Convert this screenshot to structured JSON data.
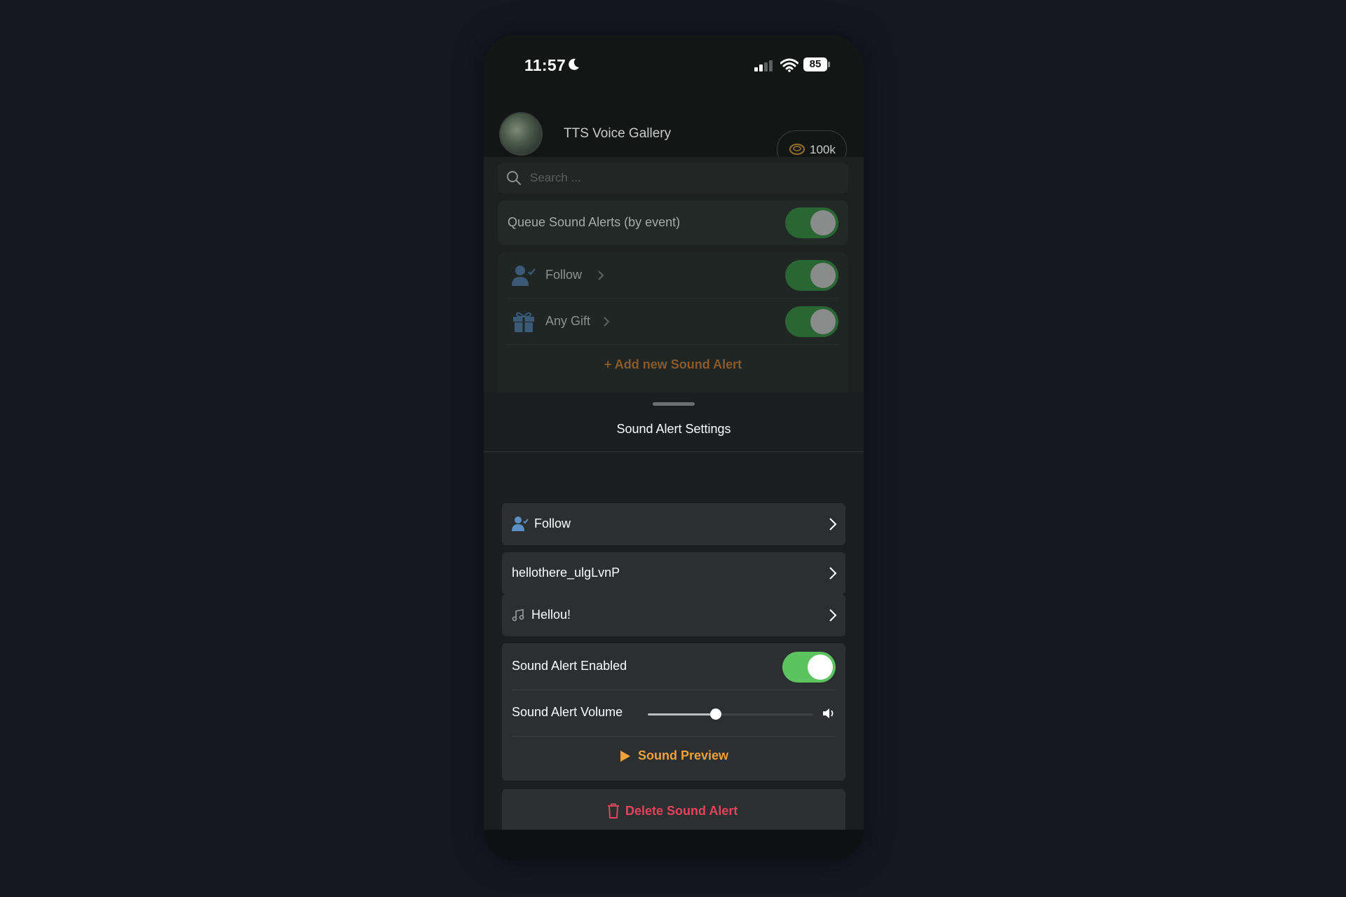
{
  "status_bar": {
    "time": "11:57",
    "battery": "85"
  },
  "header": {
    "title": "TTS Voice Gallery",
    "coins": "100k"
  },
  "search": {
    "placeholder": "Search ..."
  },
  "queue": {
    "label": "Queue Sound Alerts (by event)",
    "enabled": true
  },
  "events": [
    {
      "label": "Follow",
      "icon": "user-check-icon",
      "enabled": true
    },
    {
      "label": "Any Gift",
      "icon": "gift-icon",
      "enabled": true
    }
  ],
  "add_alert_label": "+ Add new Sound Alert",
  "sheet": {
    "title": "Sound Alert Settings",
    "event_row": {
      "label": "Follow",
      "icon": "user-check-icon"
    },
    "voice_row": {
      "label": "hellothere_ulgLvnP"
    },
    "sound_row": {
      "label": "Hellou!",
      "icon": "music-note-icon"
    },
    "enabled_label": "Sound Alert Enabled",
    "enabled": true,
    "volume_label": "Sound Alert Volume",
    "volume_fraction": 0.41,
    "preview_label": "Sound Preview",
    "delete_label": "Delete Sound Alert"
  },
  "colors": {
    "accent_orange": "#f0a13a",
    "toggle_green": "#5cc35f",
    "danger_red": "#e2445b",
    "icon_blue": "#5b8fc6"
  }
}
